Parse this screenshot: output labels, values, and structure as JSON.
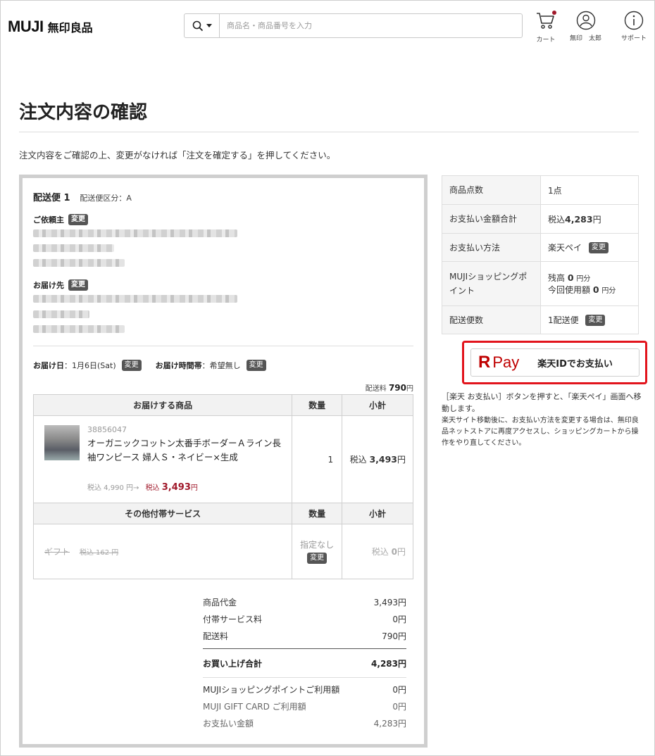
{
  "header": {
    "logo_en": "MUJI",
    "logo_ja": "無印良品",
    "search_placeholder": "商品名・商品番号を入力",
    "cart_label": "カート",
    "user_label": "無印　太郎",
    "support_label": "サポート",
    "colors": {
      "accent": "#a0182a"
    }
  },
  "page": {
    "title": "注文内容の確認",
    "lead": "注文内容をご確認の上、変更がなければ「注文を確定する」を押してください。"
  },
  "shipment": {
    "title": "配送便 1",
    "class_label": "配送便区分：A",
    "requester_label": "ご依頼主",
    "recipient_label": "お届け先",
    "change_label": "変更",
    "delivery_date_label": "お届け日",
    "delivery_date_value": "：1月6日(Sat)",
    "delivery_time_label": "お届け時間帯",
    "delivery_time_value": "：希望無し",
    "shipping_fee_prefix": "配送料",
    "shipping_fee_value": "790",
    "shipping_fee_unit": "円"
  },
  "items_table": {
    "col_product": "お届けする商品",
    "col_qty": "数量",
    "col_subtotal": "小計",
    "product": {
      "sku": "38856047",
      "name": "オーガニックコットン太番手ボーダーＡライン長袖ワンピース 婦人Ｓ・ネイビー×生成",
      "old_price": "税込 4,990 円→",
      "new_price_prefix": "税込",
      "new_price_value": "3,493",
      "new_price_unit": "円",
      "qty": "1",
      "subtotal_prefix": "税込",
      "subtotal_value": "3,493",
      "subtotal_unit": "円"
    },
    "service_header": "その他付帯サービス",
    "service": {
      "name": "ギフト",
      "price": "税込 162 円",
      "qty_text": "指定なし",
      "subtotal_prefix": "税込",
      "subtotal_value": "0",
      "subtotal_unit": "円"
    }
  },
  "summary": {
    "rows": [
      {
        "label": "商品代金",
        "value": "3,493円"
      },
      {
        "label": "付帯サービス料",
        "value": "0円"
      },
      {
        "label": "配送料",
        "value": "790円"
      }
    ],
    "total_label": "お買い上げ合計",
    "total_value": "4,283円",
    "points_label": "MUJIショッピングポイントご利用額",
    "points_value": "0円",
    "gift_label": "MUJI GIFT CARD ご利用額",
    "gift_value": "0円",
    "pay_label": "お支払い金額",
    "pay_value": "4,283円"
  },
  "info": {
    "count_label": "商品点数",
    "count_value": "1点",
    "total_label": "お支払い金額合計",
    "total_prefix": "税込",
    "total_value": "4,283",
    "total_unit": "円",
    "method_label": "お支払い方法",
    "method_value": "楽天ペイ",
    "points_label": "MUJIショッピングポイント",
    "balance_prefix": "残高",
    "balance_value": "0",
    "balance_unit": "円分",
    "use_prefix": "今回使用額",
    "use_value": "0",
    "use_unit": "円分",
    "shipments_label": "配送便数",
    "shipments_value": "1配送便",
    "change_label": "変更"
  },
  "rpay": {
    "logo_r": "R",
    "logo_pay": "Pay",
    "button_label": "楽天IDでお支払い",
    "note1": "［楽天 お支払い］ボタンを押すと、「楽天ペイ」画面へ移動します。",
    "note2": "楽天サイト移動後に、お支払い方法を変更する場合は、無印良品ネットストアに再度アクセスし、ショッピングカートから操作をやり直してください。",
    "colors": {
      "brand": "#bf0000",
      "highlight": "#e2141c"
    }
  }
}
